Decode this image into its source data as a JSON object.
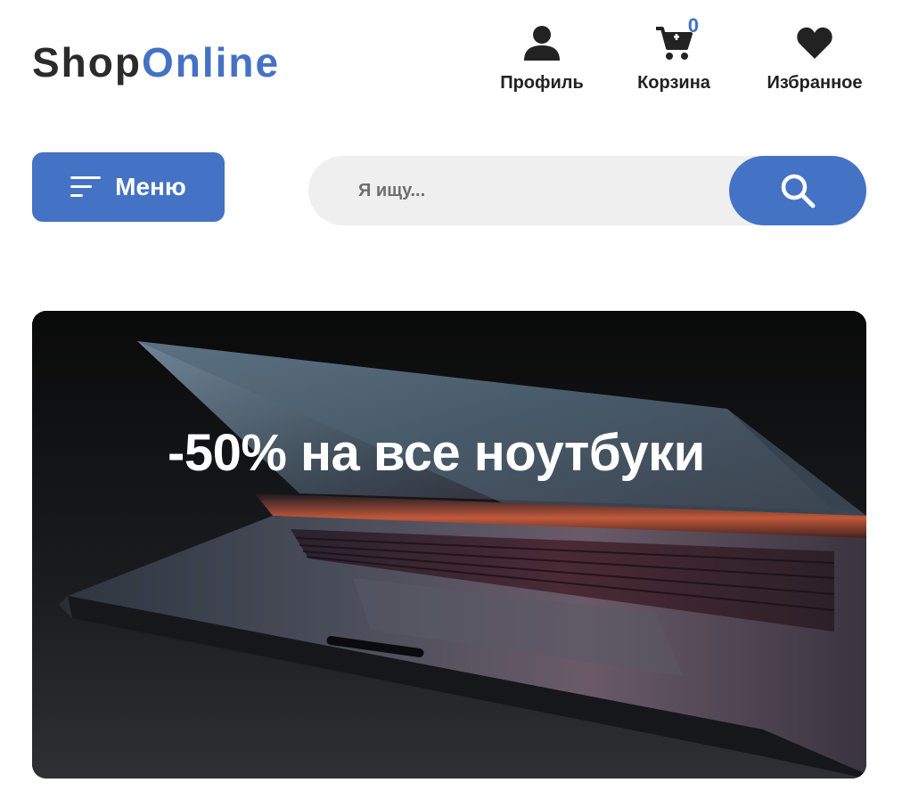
{
  "header": {
    "logo": {
      "part1": "Shop",
      "part2": "Online"
    },
    "nav": {
      "profile": {
        "label": "Профиль",
        "icon": "user-icon"
      },
      "cart": {
        "label": "Корзина",
        "icon": "cart-icon",
        "count": "0"
      },
      "favorites": {
        "label": "Избранное",
        "icon": "heart-icon"
      }
    }
  },
  "menu_button": {
    "label": "Меню",
    "icon": "menu-lines-icon"
  },
  "search": {
    "placeholder": "Я ищу...",
    "value": "",
    "icon": "search-icon"
  },
  "banner": {
    "title": "-50% на все ноутбуки"
  },
  "colors": {
    "accent": "#4472c4",
    "text": "#2b2b2b",
    "search_bg": "#efefef"
  }
}
